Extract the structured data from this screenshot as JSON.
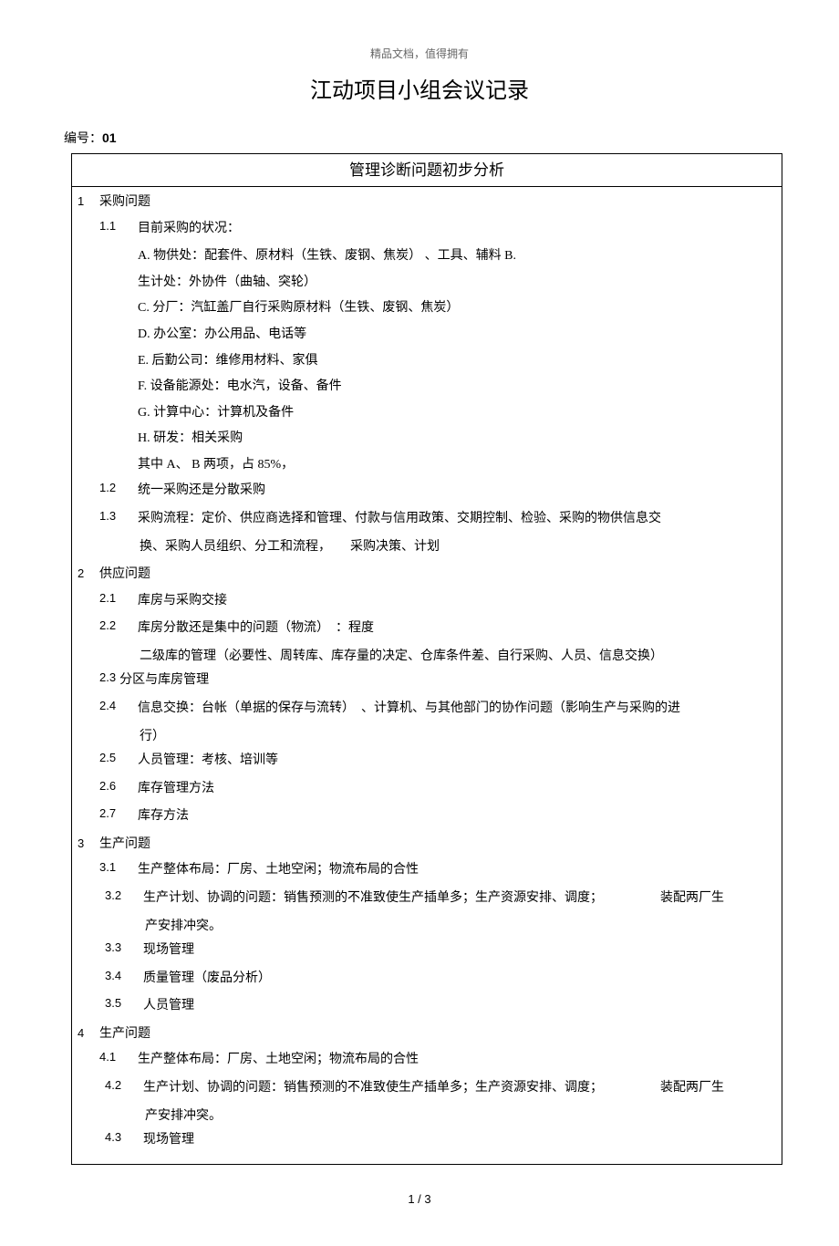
{
  "header_note": "精品文档，值得拥有",
  "title": "江动项目小组会议记录",
  "doc_number_label": "编号：",
  "doc_number_value": "01",
  "table_header": "管理诊断问题初步分析",
  "sections": {
    "s1": {
      "num": "1",
      "title": "采购问题",
      "items": {
        "i1": {
          "num": "1.1",
          "text": "目前采购的状况："
        },
        "i2": {
          "num": "1.2",
          "text": "统一采购还是分散采购"
        },
        "i3": {
          "num": "1.3",
          "text": "采购流程：定价、供应商选择和管理、付款与信用政策、交期控制、检验、采购的物供信息交"
        },
        "i3b": "换、采购人员组织、分工和流程，　　采购决策、计划"
      },
      "list": {
        "a": "A. 物供处：配套件、原材料（生铁、废钢、焦炭） 、工具、辅料 B.",
        "a2": "生计处：外协件（曲轴、突轮）",
        "c": "C. 分厂：汽缸盖厂自行采购原材料（生铁、废钢、焦炭）",
        "d": "D. 办公室：办公用品、电话等",
        "e": "E. 后勤公司：维修用材料、家俱",
        "f": "F. 设备能源处：电水汽，设备、备件",
        "g": "G. 计算中心：计算机及备件",
        "h": "H. 研发：相关采购",
        "note": "其中 A、 B 两项，占 85%，"
      }
    },
    "s2": {
      "num": "2",
      "title": "供应问题",
      "items": {
        "i1": {
          "num": "2.1",
          "text": "库房与采购交接"
        },
        "i2": {
          "num": "2.2",
          "text": "库房分散还是集中的问题（物流）　：程度"
        },
        "i2b": "二级库的管理（必要性、周转库、库存量的决定、仓库条件差、自行采购、人员、信息交换）",
        "i3": {
          "num": "2.3",
          "text": "分区与库房管理"
        },
        "i4": {
          "num": "2.4",
          "text": "信息交换：台帐（单据的保存与流转）　、计算机、与其他部门的协作问题（影响生产与采购的进"
        },
        "i4b": "行）",
        "i5": {
          "num": "2.5",
          "text": "人员管理：考核、培训等"
        },
        "i6": {
          "num": "2.6",
          "text": "库存管理方法"
        },
        "i7": {
          "num": "2.7",
          "text": "库存方法"
        }
      }
    },
    "s3": {
      "num": "3",
      "title": "生产问题",
      "items": {
        "i1": {
          "num": "3.1",
          "text": "生产整体布局：厂房、土地空闲；物流布局的合性"
        },
        "i2": {
          "num": "3.2",
          "text": "生产计划、协调的问题：销售预测的不准致使生产插单多；生产资源安排、调度；　　　　　装配两厂生"
        },
        "i2b": "产安排冲突。",
        "i3": {
          "num": "3.3",
          "text": "现场管理"
        },
        "i4": {
          "num": "3.4",
          "text": "质量管理（废品分析）"
        },
        "i5": {
          "num": "3.5",
          "text": "人员管理"
        }
      }
    },
    "s4": {
      "num": "4",
      "title": "生产问题",
      "items": {
        "i1": {
          "num": "4.1",
          "text": "生产整体布局：厂房、土地空闲；物流布局的合性"
        },
        "i2": {
          "num": "4.2",
          "text": "生产计划、协调的问题：销售预测的不准致使生产插单多；生产资源安排、调度；　　　　　装配两厂生"
        },
        "i2b": "产安排冲突。",
        "i3": {
          "num": "4.3",
          "text": "现场管理"
        }
      }
    }
  },
  "footer": "1 / 3"
}
